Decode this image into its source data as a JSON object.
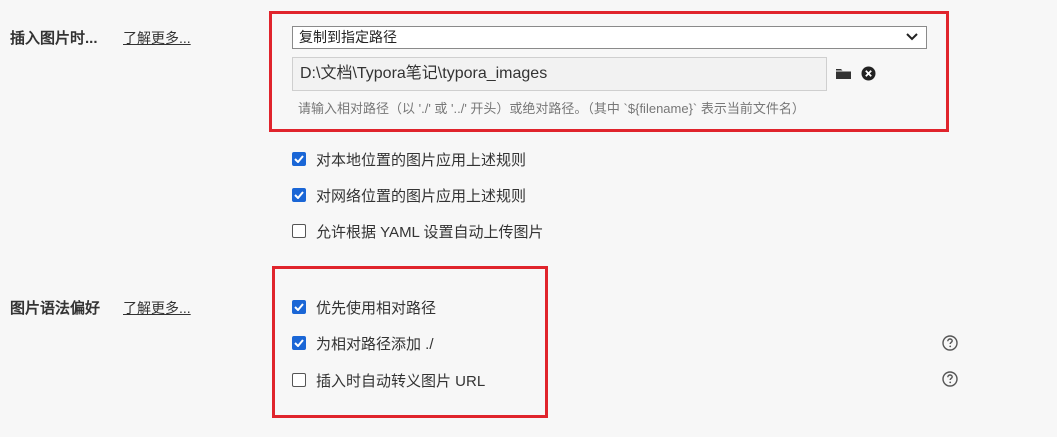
{
  "insert_image": {
    "title": "插入图片时...",
    "learn_more": "了解更多...",
    "action_selected": "复制到指定路径",
    "path_value": "D:\\文档\\Typora笔记\\typora_images",
    "hint": "请输入相对路径（以 './' 或 '../' 开头）或绝对路径。（其中 `${filename}` 表示当前文件名）",
    "options": [
      {
        "label": "对本地位置的图片应用上述规则",
        "checked": true
      },
      {
        "label": "对网络位置的图片应用上述规则",
        "checked": true
      },
      {
        "label": "允许根据 YAML 设置自动上传图片",
        "checked": false
      }
    ]
  },
  "image_syntax": {
    "title": "图片语法偏好",
    "learn_more": "了解更多...",
    "options": [
      {
        "label": "优先使用相对路径",
        "checked": true
      },
      {
        "label": "为相对路径添加 ./",
        "checked": true
      },
      {
        "label": "插入时自动转义图片 URL",
        "checked": false
      }
    ]
  },
  "colors": {
    "highlight": "#e0242c",
    "checkbox": "#1a66d6"
  },
  "icons": [
    "chevron-down-icon",
    "folder-icon",
    "clear-icon",
    "help-icon"
  ]
}
